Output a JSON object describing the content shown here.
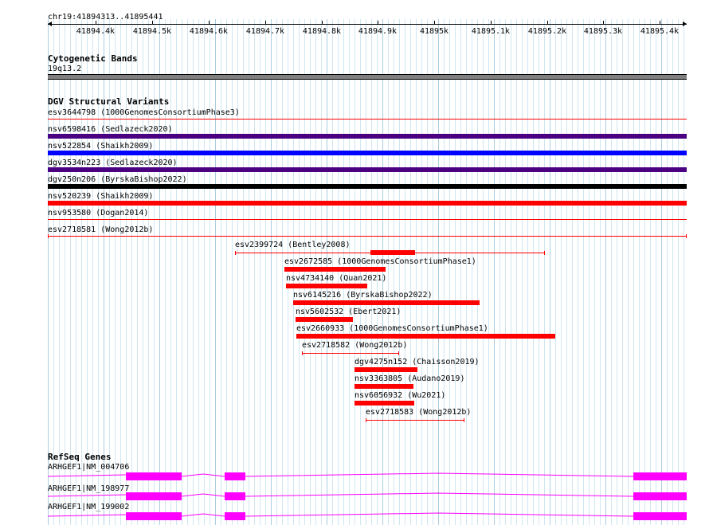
{
  "ruler": {
    "position": "chr19:41894313..41895441",
    "ticks": [
      "41894.4k",
      "41894.5k",
      "41894.6k",
      "41894.7k",
      "41894.8k",
      "41894.9k",
      "41895k",
      "41895.1k",
      "41895.2k",
      "41895.3k",
      "41895.4k"
    ]
  },
  "cytoband": {
    "title": "Cytogenetic Bands",
    "band": "19q13.2",
    "color": "#808080"
  },
  "dgv": {
    "title": "DGV Structural Variants",
    "colors": {
      "red": "#ff0000",
      "blue": "#0000ff",
      "purple": "#4b0082",
      "black": "#000000"
    },
    "fullWidth": [
      {
        "label": "esv3644798 (1000GenomesConsortiumPhase3)",
        "color": "red",
        "style": "thin"
      },
      {
        "label": "nsv6598416 (Sedlazeck2020)",
        "color": "purple",
        "style": "thick"
      },
      {
        "label": "nsv522854 (Shaikh2009)",
        "color": "blue",
        "style": "thick"
      },
      {
        "label": "dgv3534n223 (Sedlazeck2020)",
        "color": "purple",
        "style": "thick"
      },
      {
        "label": "dgv250n206 (ByrskaBishop2022)",
        "color": "black",
        "style": "thick"
      },
      {
        "label": "nsv520239 (Shaikh2009)",
        "color": "red",
        "style": "thick"
      },
      {
        "label": "nsv953580 (Dogan2014)",
        "color": "red",
        "style": "thin"
      },
      {
        "label": "esv2718581 (Wong2012b)",
        "color": "red",
        "style": "capped"
      }
    ],
    "partial": [
      {
        "label": "esv2399724 (Bentley2008)"
      },
      {
        "label": "esv2672585 (1000GenomesConsortiumPhase1)"
      },
      {
        "label": "nsv4734140 (Quan2021)"
      },
      {
        "label": "nsv6145216 (ByrskaBishop2022)"
      },
      {
        "label": "nsv5602532 (Ebert2021)"
      },
      {
        "label": "esv2660933 (1000GenomesConsortiumPhase1)"
      },
      {
        "label": "esv2718582 (Wong2012b)"
      },
      {
        "label": "dgv4275n152 (Chaisson2019)"
      },
      {
        "label": "nsv3363805 (Audano2019)"
      },
      {
        "label": "nsv6056932 (Wu2021)"
      },
      {
        "label": "esv2718583 (Wong2012b)"
      }
    ]
  },
  "refseq": {
    "title": "RefSeq Genes",
    "color": "#ff00ff",
    "genes": [
      {
        "label": "ARHGEF1|NM_004706"
      },
      {
        "label": "ARHGEF1|NM_198977"
      },
      {
        "label": "ARHGEF1|NM_199002"
      }
    ]
  }
}
